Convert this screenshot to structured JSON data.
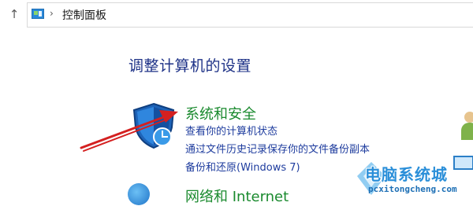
{
  "address_bar": {
    "up_glyph": "↑",
    "location_icon": "control-panel-icon",
    "separator_glyph": "›",
    "crumb": "控制面板"
  },
  "main": {
    "heading": "调整计算机的设置",
    "categories": [
      {
        "title": "系统和安全",
        "icon": "shield-icon",
        "links": [
          "查看你的计算机状态",
          "通过文件历史记录保存你的文件备份副本",
          "备份和还原(Windows 7)"
        ]
      },
      {
        "title": "网络和 Internet",
        "icon": "globe-icon"
      }
    ]
  },
  "watermark": {
    "title": "电脑系统城",
    "url": "pcxitongcheng.com"
  },
  "colors": {
    "heading": "#1e3287",
    "category_title": "#1a8a2e",
    "link": "#1e3c9e",
    "annotation_arrow": "#d42020",
    "watermark": "#2b8fd9"
  }
}
